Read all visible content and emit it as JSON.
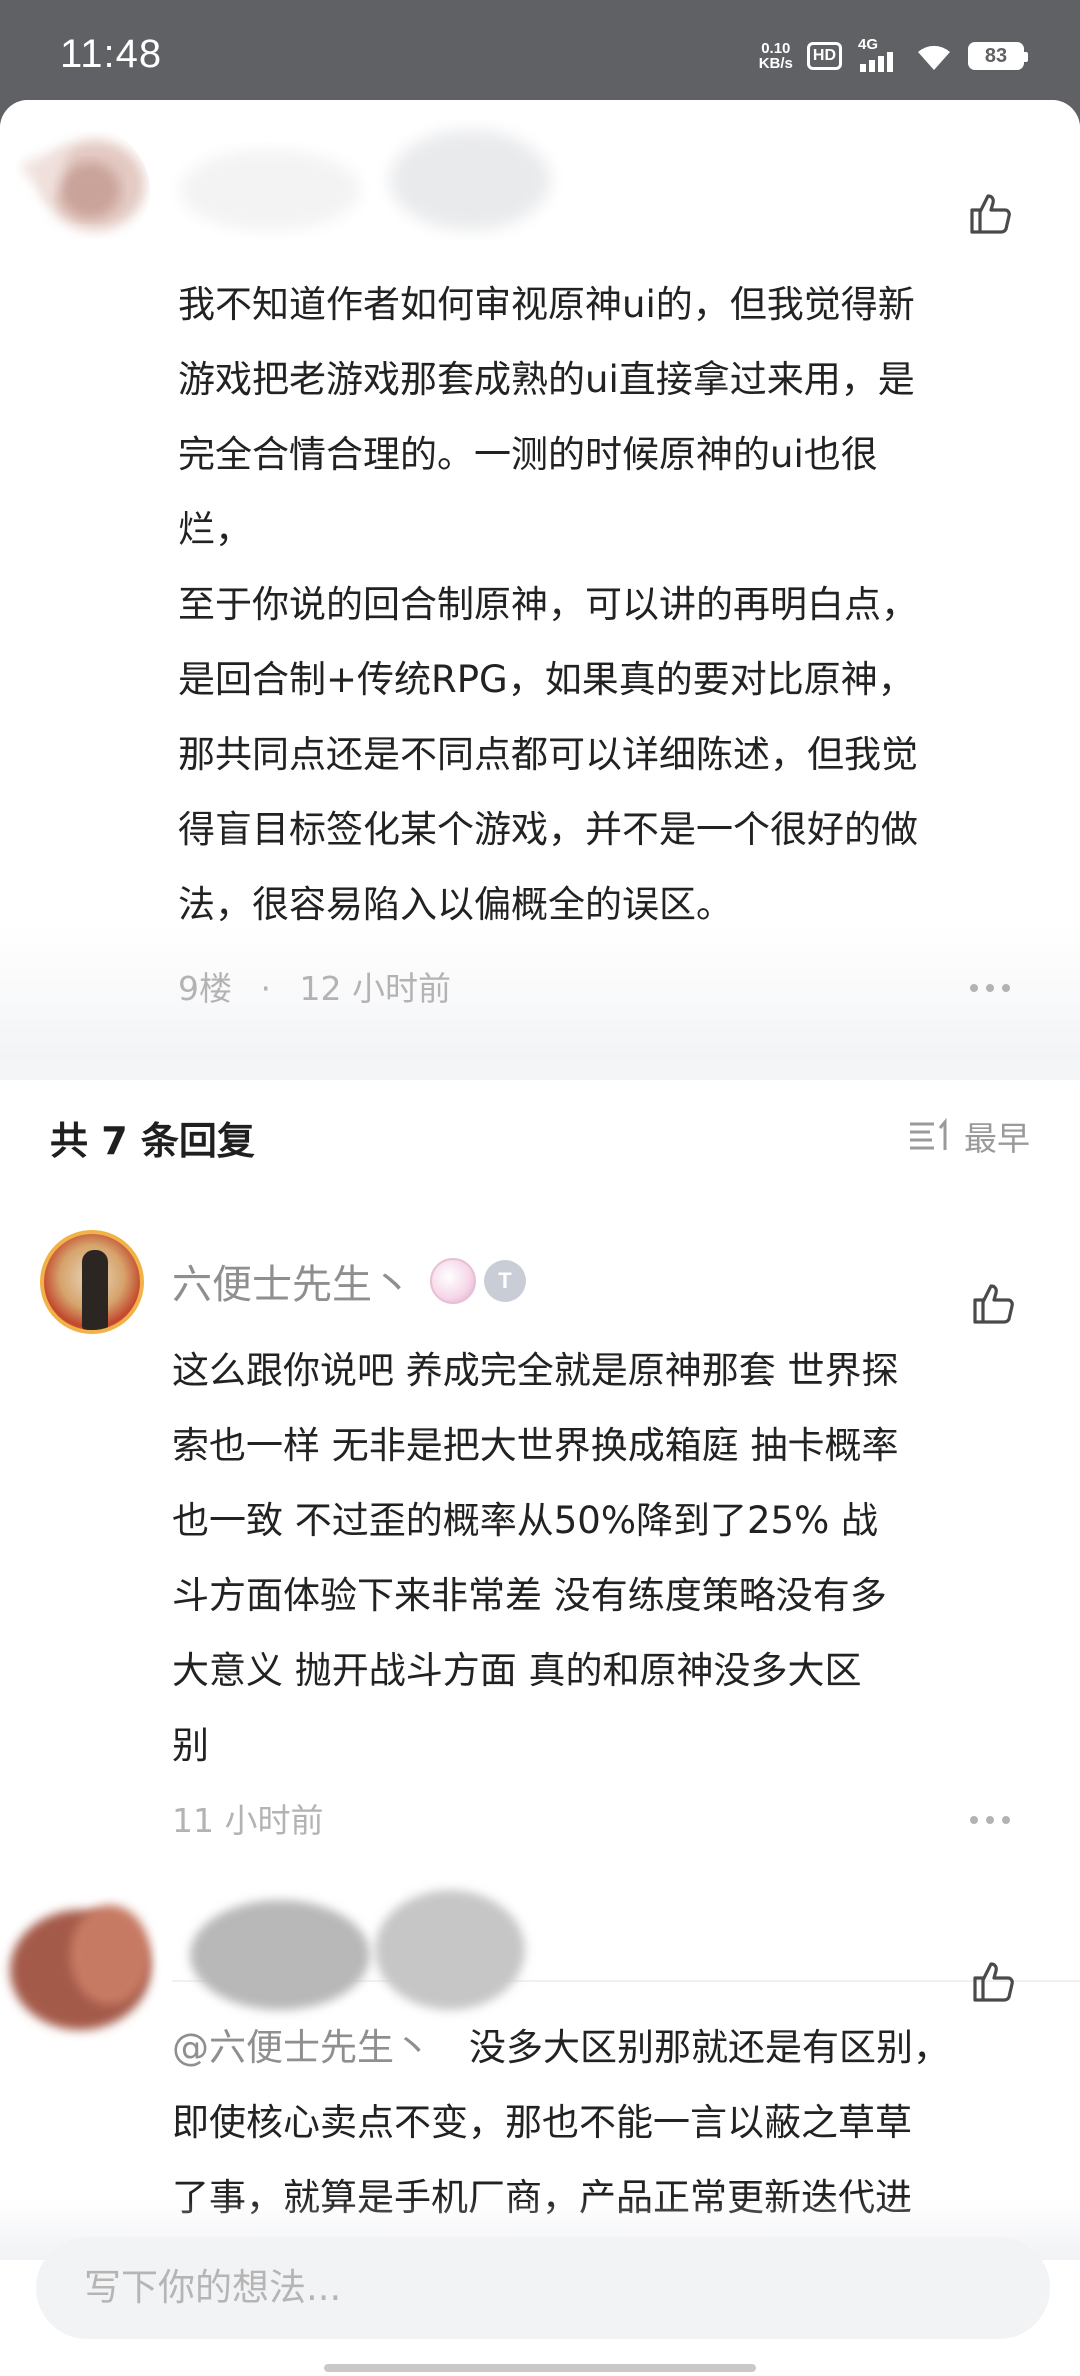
{
  "status_bar": {
    "time": "11:48",
    "net_speed_value": "0.10",
    "net_speed_unit": "KB/s",
    "hd_label": "HD",
    "network_label": "4G",
    "battery": "83"
  },
  "main_comment": {
    "text": "我不知道作者如何审视原神ui的，但我觉得新\n游戏把老游戏那套成熟的ui直接拿过来用，是\n完全合情合理的。一测的时候原神的ui也很\n烂，\n至于你说的回合制原神，可以讲的再明白点，\n是回合制+传统RPG，如果真的要对比原神，\n那共同点还是不同点都可以详细陈述，但我觉\n得盲目标签化某个游戏，并不是一个很好的做\n法，很容易陷入以偏概全的误区。",
    "floor": "9楼",
    "separator": "·",
    "time": "12 小时前"
  },
  "replies": {
    "header": "共 7 条回复",
    "sort_label": "最早",
    "items": [
      {
        "username": "六便士先生丶",
        "text": "这么跟你说吧  养成完全就是原神那套  世界探\n索也一样 无非是把大世界换成箱庭  抽卡概率\n也一致  不过歪的概率从50%降到了25%  战\n斗方面体验下来非常差  没有练度策略没有多\n大意义    抛开战斗方面   真的和原神没多大区\n别",
        "time": "11 小时前",
        "badge_text": "T"
      },
      {
        "mention": "@六便士先生丶",
        "text": "没多大区别那就还是有区别，\n即使核心卖点不变，那也不能一言以蔽之草草\n了事，就算是手机厂商，产品正常更新迭代进"
      }
    ]
  },
  "composer": {
    "placeholder": "写下你的想法..."
  },
  "colors": {
    "status_bar_bg": "#5f6164",
    "muted_text": "#b3b3b3",
    "body_text": "#222222"
  }
}
